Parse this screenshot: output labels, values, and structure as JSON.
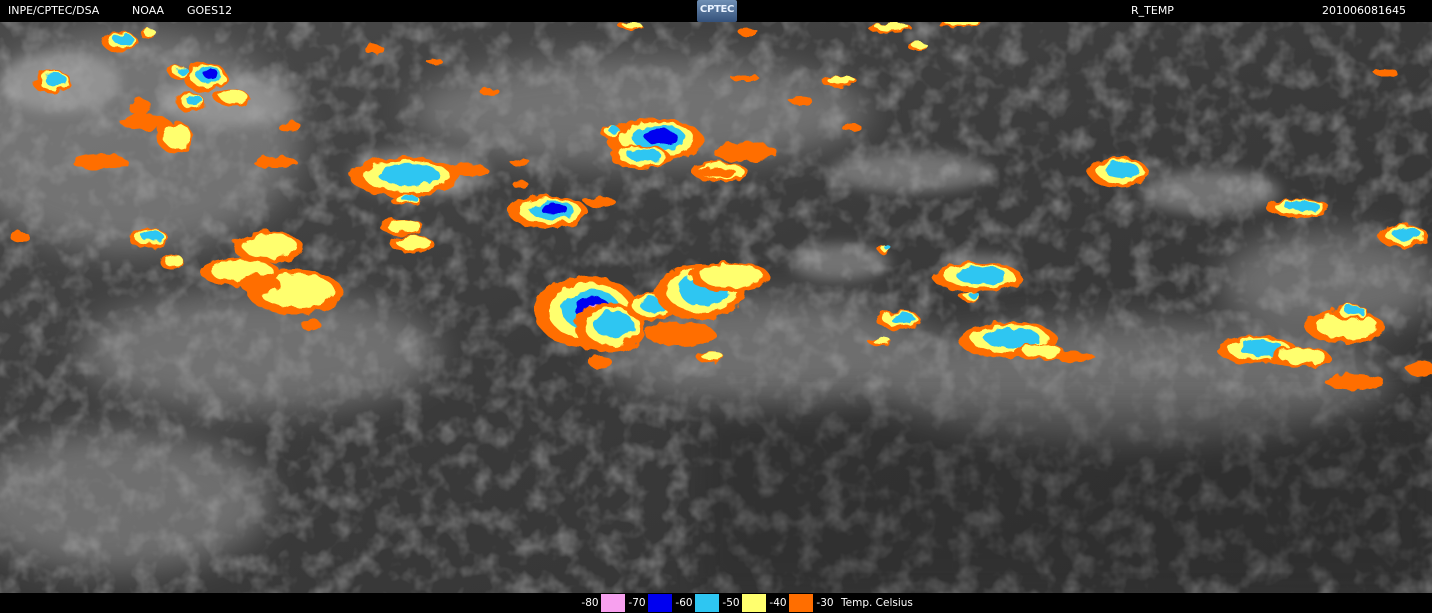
{
  "header": {
    "agency": "INPE/CPTEC/DSA",
    "satellite_owner": "NOAA",
    "satellite": "GOES12",
    "logo_text": "CPTEC",
    "product": "R_TEMP",
    "datetime": "201006081645"
  },
  "legend": {
    "unit_label": "Temp. Celsius",
    "items": [
      {
        "value": "-80",
        "color": "#f7a0ee",
        "icon": "color-swatch"
      },
      {
        "value": "-70",
        "color": "#0000f0",
        "icon": "color-swatch"
      },
      {
        "value": "-60",
        "color": "#2ec6f2",
        "icon": "color-swatch"
      },
      {
        "value": "-50",
        "color": "#ffff6e",
        "icon": "color-swatch"
      },
      {
        "value": "-40",
        "color": "#ff6e00",
        "icon": "color-swatch"
      },
      {
        "value": "-30",
        "color": null,
        "icon": "no-swatch"
      }
    ]
  },
  "imagery": {
    "icon": "infrared-satellite-image",
    "background_color": "#3a3a3a"
  }
}
